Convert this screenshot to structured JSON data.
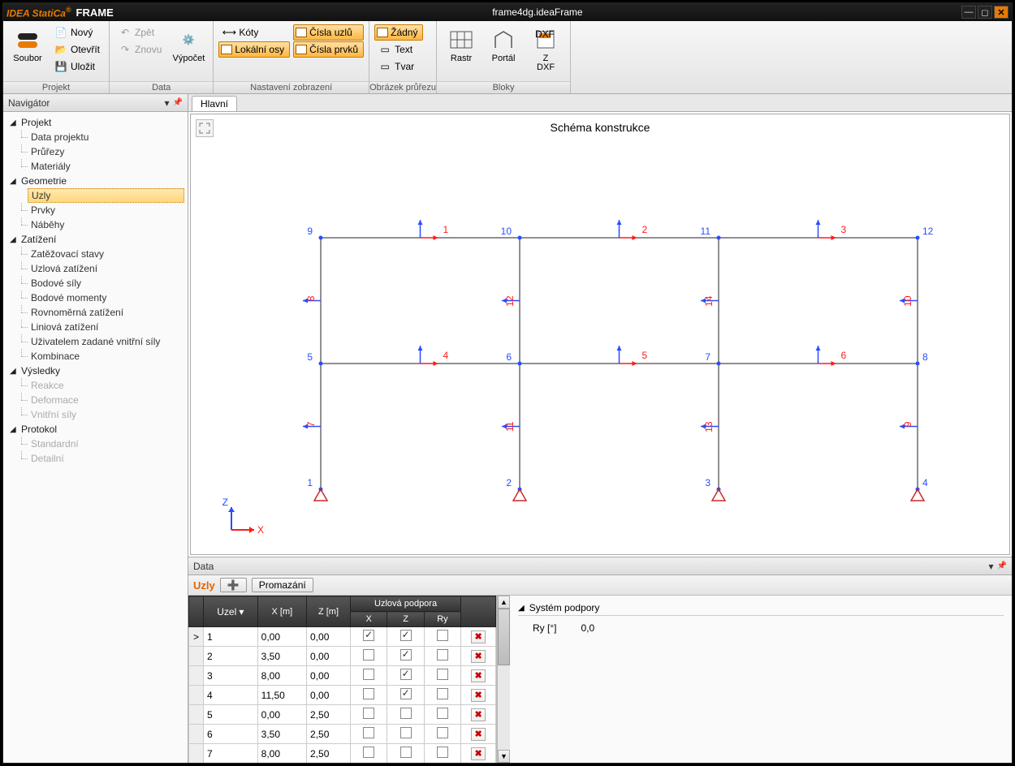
{
  "title": {
    "brand": "IDEA StatiCa",
    "product": "FRAME",
    "file": "frame4dg.ideaFrame"
  },
  "ribbon": {
    "groups": {
      "projekt": {
        "label": "Projekt",
        "soubor": "Soubor",
        "novy": "Nový",
        "otevrit": "Otevřít",
        "ulozit": "Uložit"
      },
      "data": {
        "label": "Data",
        "zpet": "Zpět",
        "znovu": "Znovu",
        "vypocet": "Výpočet"
      },
      "nastaveni": {
        "label": "Nastavení zobrazení",
        "koty": "Kóty",
        "lokalni": "Lokální osy",
        "cislauzlu": "Čísla uzlů",
        "cislaprvku": "Čísla prvků"
      },
      "obrazek": {
        "label": "Obrázek průřezu",
        "zadny": "Žádný",
        "text": "Text",
        "tvar": "Tvar"
      },
      "bloky": {
        "label": "Bloky",
        "rastr": "Rastr",
        "portal": "Portál",
        "zdxf": "Z\nDXF"
      }
    }
  },
  "navigator": {
    "title": "Navigátor",
    "projekt": {
      "title": "Projekt",
      "items": [
        "Data projektu",
        "Průřezy",
        "Materiály"
      ]
    },
    "geometrie": {
      "title": "Geometrie",
      "items": [
        "Uzly",
        "Prvky",
        "Náběhy"
      ],
      "selected": 0
    },
    "zatizeni": {
      "title": "Zatížení",
      "items": [
        "Zatěžovací stavy",
        "Uzlová zatížení",
        "Bodové síly",
        "Bodové momenty",
        "Rovnoměrná zatížení",
        "Liniová zatížení",
        "Uživatelem zadané vnitřní síly",
        "Kombinace"
      ]
    },
    "vysledky": {
      "title": "Výsledky",
      "items": [
        "Reakce",
        "Deformace",
        "Vnitřní síly"
      ]
    },
    "protokol": {
      "title": "Protokol",
      "items": [
        "Standardní",
        "Detailní"
      ]
    }
  },
  "main": {
    "tab": "Hlavní",
    "schema_title": "Schéma konstrukce",
    "axis_x": "X",
    "axis_z": "Z"
  },
  "schema": {
    "nodes": [
      {
        "id": 1,
        "xg": 0,
        "zg": 0
      },
      {
        "id": 2,
        "xg": 1,
        "zg": 0
      },
      {
        "id": 3,
        "xg": 2,
        "zg": 0
      },
      {
        "id": 4,
        "xg": 3,
        "zg": 0
      },
      {
        "id": 5,
        "xg": 0,
        "zg": 1
      },
      {
        "id": 6,
        "xg": 1,
        "zg": 1
      },
      {
        "id": 7,
        "xg": 2,
        "zg": 1
      },
      {
        "id": 8,
        "xg": 3,
        "zg": 1
      },
      {
        "id": 9,
        "xg": 0,
        "zg": 2
      },
      {
        "id": 10,
        "xg": 1,
        "zg": 2
      },
      {
        "id": 11,
        "xg": 2,
        "zg": 2
      },
      {
        "id": 12,
        "xg": 3,
        "zg": 2
      }
    ],
    "members": [
      {
        "id": 7,
        "a": 1,
        "b": 5
      },
      {
        "id": 8,
        "a": 5,
        "b": 9
      },
      {
        "id": 11,
        "a": 2,
        "b": 6
      },
      {
        "id": 12,
        "a": 6,
        "b": 10
      },
      {
        "id": 13,
        "a": 3,
        "b": 7
      },
      {
        "id": 14,
        "a": 7,
        "b": 11
      },
      {
        "id": 9,
        "a": 4,
        "b": 8
      },
      {
        "id": 10,
        "a": 8,
        "b": 12
      },
      {
        "id": 4,
        "a": 5,
        "b": 6
      },
      {
        "id": 5,
        "a": 6,
        "b": 7
      },
      {
        "id": 6,
        "a": 7,
        "b": 8
      },
      {
        "id": 1,
        "a": 9,
        "b": 10
      },
      {
        "id": 2,
        "a": 10,
        "b": 11
      },
      {
        "id": 3,
        "a": 11,
        "b": 12
      }
    ],
    "supports": [
      1,
      2,
      3,
      4
    ]
  },
  "datapanel": {
    "title": "Data",
    "tab": "Uzly",
    "add": "",
    "promazani": "Promazání",
    "headers": {
      "uzel": "Uzel",
      "x": "X [m]",
      "z": "Z [m]",
      "podpora": "Uzlová podpora",
      "px": "X",
      "pz": "Z",
      "pry": "Ry"
    },
    "rows": [
      {
        "u": "1",
        "x": "0,00",
        "z": "0,00",
        "sx": true,
        "sz": true,
        "sry": false,
        "sel": true
      },
      {
        "u": "2",
        "x": "3,50",
        "z": "0,00",
        "sx": false,
        "sz": true,
        "sry": false
      },
      {
        "u": "3",
        "x": "8,00",
        "z": "0,00",
        "sx": false,
        "sz": true,
        "sry": false
      },
      {
        "u": "4",
        "x": "11,50",
        "z": "0,00",
        "sx": false,
        "sz": true,
        "sry": false
      },
      {
        "u": "5",
        "x": "0,00",
        "z": "2,50",
        "sx": false,
        "sz": false,
        "sry": false
      },
      {
        "u": "6",
        "x": "3,50",
        "z": "2,50",
        "sx": false,
        "sz": false,
        "sry": false
      },
      {
        "u": "7",
        "x": "8,00",
        "z": "2,50",
        "sx": false,
        "sz": false,
        "sry": false
      }
    ],
    "props": {
      "section": "Systém podpory",
      "ry_label": "Ry [°]",
      "ry_val": "0,0"
    }
  }
}
